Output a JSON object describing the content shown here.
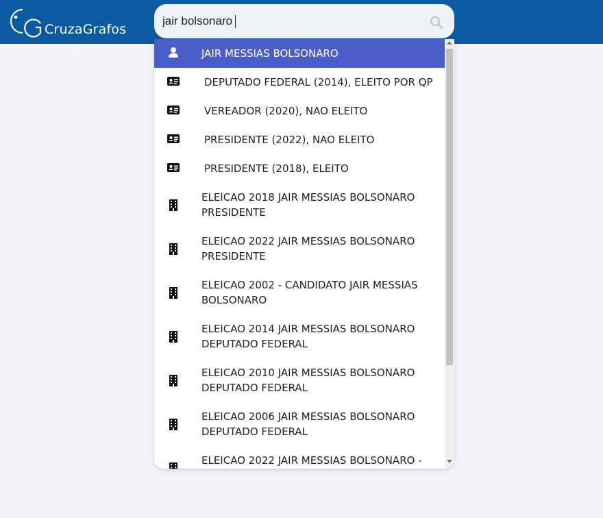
{
  "brand": {
    "name": "CruzaGrafos",
    "colors": {
      "topbar": "#0b5aa2",
      "selected": "#4a5dc8",
      "background": "#f2f2f8"
    }
  },
  "search": {
    "value": "jair bolsonaro",
    "icon": "search-icon"
  },
  "suggestions": [
    {
      "icon": "user-icon",
      "label": "JAIR MESSIAS BOLSONARO",
      "selected": true
    },
    {
      "icon": "id-card-icon",
      "label": "DEPUTADO FEDERAL (2014), ELEITO POR QP"
    },
    {
      "icon": "id-card-icon",
      "label": "VEREADOR (2020), NAO ELEITO"
    },
    {
      "icon": "id-card-icon",
      "label": "PRESIDENTE (2022), NAO ELEITO"
    },
    {
      "icon": "id-card-icon",
      "label": "PRESIDENTE (2018), ELEITO"
    },
    {
      "icon": "building-icon",
      "label": "ELEICAO 2018 JAIR MESSIAS BOLSONARO PRESIDENTE"
    },
    {
      "icon": "building-icon",
      "label": "ELEICAO 2022 JAIR MESSIAS BOLSONARO PRESIDENTE"
    },
    {
      "icon": "building-icon",
      "label": "ELEICAO 2002 - CANDIDATO JAIR MESSIAS BOLSONARO"
    },
    {
      "icon": "building-icon",
      "label": "ELEICAO 2014 JAIR MESSIAS BOLSONARO DEPUTADO FEDERAL"
    },
    {
      "icon": "building-icon",
      "label": "ELEICAO 2010 JAIR MESSIAS BOLSONARO DEPUTADO FEDERAL"
    },
    {
      "icon": "building-icon",
      "label": "ELEICAO 2006 JAIR MESSIAS BOLSONARO DEPUTADO FEDERAL"
    },
    {
      "icon": "building-icon",
      "label": "ELEICAO 2022 JAIR MESSIAS BOLSONARO -"
    }
  ]
}
